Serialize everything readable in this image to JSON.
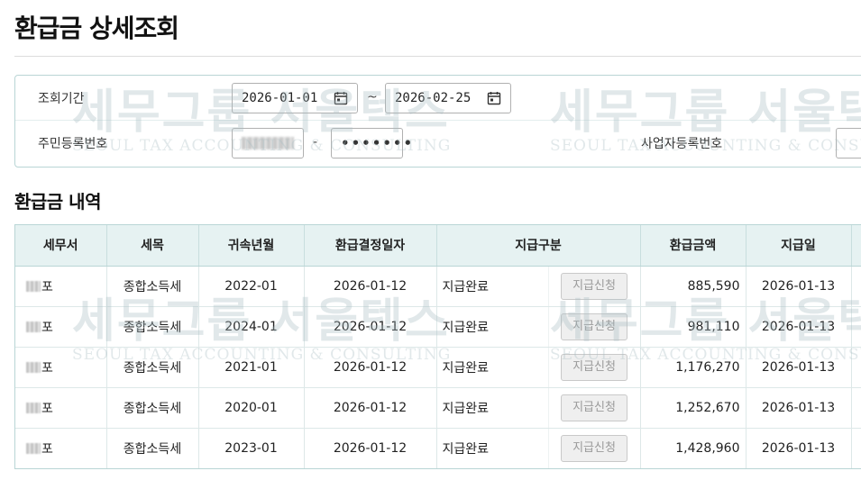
{
  "page": {
    "title": "환급금 상세조회"
  },
  "search": {
    "period_label": "조회기간",
    "start_date": "2026-01-01",
    "tilde": "~",
    "end_date": "2026-02-25",
    "rrn_label": "주민등록번호",
    "rrn_dash": "-",
    "rrn_back_masked": "•••••••",
    "biz_label": "사업자등록번호"
  },
  "section": {
    "title": "환급금 내역"
  },
  "table": {
    "headers": [
      "세무서",
      "세목",
      "귀속년월",
      "환급결정일자",
      "지급구분",
      "환급금액",
      "지급일"
    ],
    "rows": [
      {
        "office": "포",
        "tax_type": "종합소득세",
        "period": "2022-01",
        "decision_date": "2026-01-12",
        "status": "지급완료",
        "button": "지급신청",
        "amount": "885,590",
        "pay_date": "2026-01-13"
      },
      {
        "office": "포",
        "tax_type": "종합소득세",
        "period": "2024-01",
        "decision_date": "2026-01-12",
        "status": "지급완료",
        "button": "지급신청",
        "amount": "981,110",
        "pay_date": "2026-01-13"
      },
      {
        "office": "포",
        "tax_type": "종합소득세",
        "period": "2021-01",
        "decision_date": "2026-01-12",
        "status": "지급완료",
        "button": "지급신청",
        "amount": "1,176,270",
        "pay_date": "2026-01-13"
      },
      {
        "office": "포",
        "tax_type": "종합소득세",
        "period": "2020-01",
        "decision_date": "2026-01-12",
        "status": "지급완료",
        "button": "지급신청",
        "amount": "1,252,670",
        "pay_date": "2026-01-13"
      },
      {
        "office": "포",
        "tax_type": "종합소득세",
        "period": "2023-01",
        "decision_date": "2026-01-12",
        "status": "지급완료",
        "button": "지급신청",
        "amount": "1,428,960",
        "pay_date": "2026-01-13"
      }
    ]
  },
  "watermark": {
    "main": "세무그룹 서울텍스",
    "main_partial": "세무그룹 서울택",
    "sub": "SEOUL TAX ACCOUNTING & CONSULTING",
    "sub_partial": "SEOUL TAX ACCOUNTING & CONSULT"
  },
  "colors": {
    "header_bg": "#e6f2f2",
    "border": "#b9d5d5",
    "button_bg": "#efefef"
  },
  "icons": {
    "calendar": "calendar-icon"
  }
}
